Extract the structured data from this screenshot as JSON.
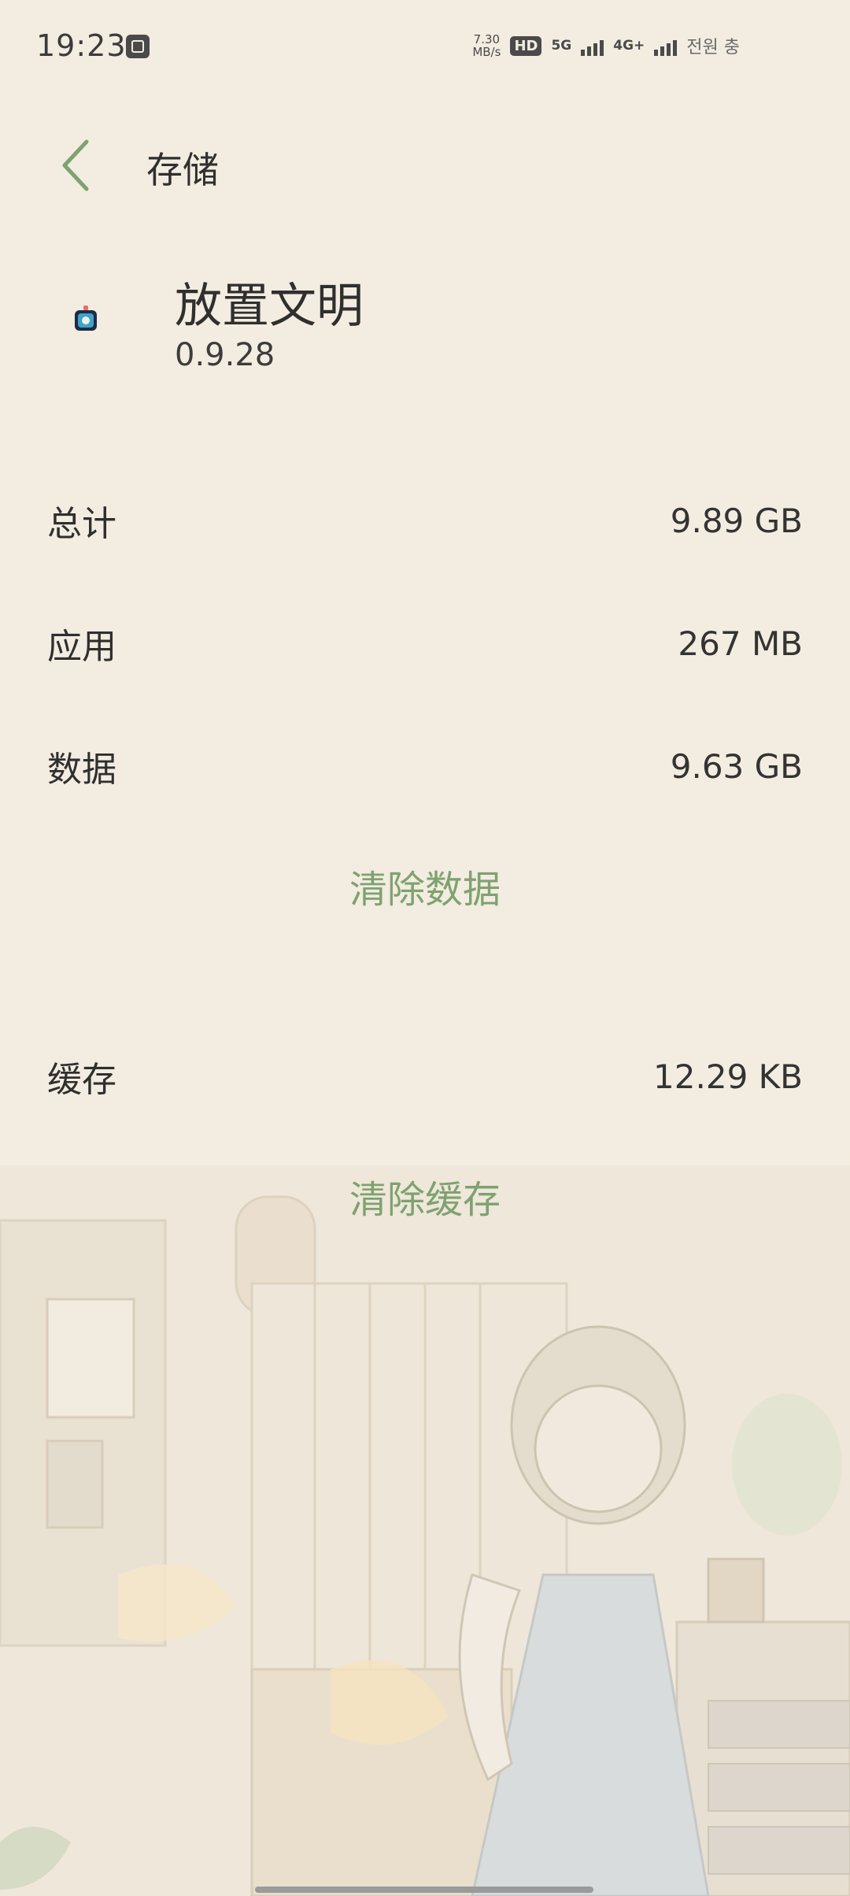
{
  "status_bar": {
    "time": "19:23",
    "speed_value": "7.30",
    "speed_unit": "MB/s",
    "hd_badge": "HD",
    "network_5g": "5G",
    "network_4g": "4G+",
    "carrier": "전원 충",
    "icons": [
      "screenshot-app-icon",
      "hd-icon",
      "signal-5g-icon",
      "signal-4g-icon"
    ]
  },
  "header": {
    "title": "存储",
    "back_icon": "chevron-left-icon"
  },
  "app": {
    "name": "放置文明",
    "version": "0.9.28",
    "icon": "app-icon"
  },
  "storage": {
    "total_label": "总计",
    "total_value": "9.89 GB",
    "app_label": "应用",
    "app_value": "267 MB",
    "data_label": "数据",
    "data_value": "9.63 GB",
    "clear_data_label": "清除数据",
    "cache_label": "缓存",
    "cache_value": "12.29 KB",
    "clear_cache_label": "清除缓存"
  },
  "colors": {
    "background": "#f3ece0",
    "accent": "#7ea271",
    "text": "#2f2f2f"
  }
}
